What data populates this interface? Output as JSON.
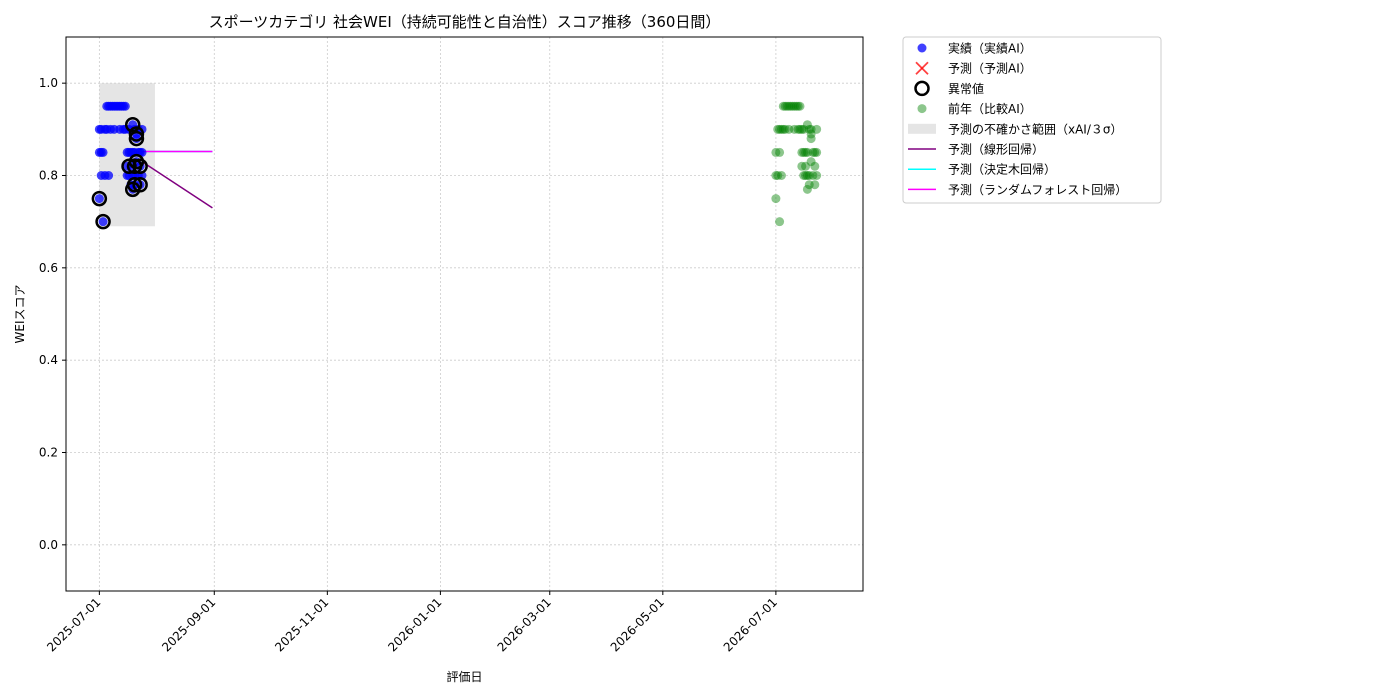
{
  "chart_data": {
    "type": "scatter",
    "title": "スポーツカテゴリ 社会WEI（持続可能性と自治性）スコア推移（360日間）",
    "xlabel": "評価日",
    "ylabel": "WEIスコア",
    "xlim": [
      "2025-06-13",
      "2026-08-17"
    ],
    "ylim": [
      -0.1,
      1.1
    ],
    "x_ticks": [
      "2025-07-01",
      "2025-09-01",
      "2025-11-01",
      "2026-01-01",
      "2026-03-01",
      "2026-05-01",
      "2026-07-01"
    ],
    "y_ticks": [
      0.0,
      0.2,
      0.4,
      0.6,
      0.8,
      1.0
    ],
    "y_tick_labels": [
      "0.0",
      "0.2",
      "0.4",
      "0.6",
      "0.8",
      "1.0"
    ],
    "grid": true,
    "legend_position": "outside-top-right",
    "colors": {
      "actual": "#0000ff",
      "forecast": "#ff0000",
      "anomaly": "#000000",
      "previous_year": "#008000",
      "band": "#d3d3d3",
      "linear": "#800080",
      "tree": "#00ffff",
      "forest": "#ff00ff"
    },
    "series": [
      {
        "name": "実績（実績AI）",
        "kind": "scatter",
        "color": "#0000ff",
        "points": [
          [
            "2025-07-01",
            0.75
          ],
          [
            "2025-07-01",
            0.85
          ],
          [
            "2025-07-01",
            0.9
          ],
          [
            "2025-07-02",
            0.8
          ],
          [
            "2025-07-02",
            0.85
          ],
          [
            "2025-07-02",
            0.9
          ],
          [
            "2025-07-03",
            0.7
          ],
          [
            "2025-07-03",
            0.85
          ],
          [
            "2025-07-04",
            0.9
          ],
          [
            "2025-07-04",
            0.8
          ],
          [
            "2025-07-05",
            0.95
          ],
          [
            "2025-07-05",
            0.9
          ],
          [
            "2025-07-06",
            0.8
          ],
          [
            "2025-07-06",
            0.95
          ],
          [
            "2025-07-07",
            0.95
          ],
          [
            "2025-07-07",
            0.9
          ],
          [
            "2025-07-08",
            0.95
          ],
          [
            "2025-07-09",
            0.95
          ],
          [
            "2025-07-09",
            0.9
          ],
          [
            "2025-07-10",
            0.95
          ],
          [
            "2025-07-11",
            0.95
          ],
          [
            "2025-07-12",
            0.95
          ],
          [
            "2025-07-12",
            0.9
          ],
          [
            "2025-07-13",
            0.95
          ],
          [
            "2025-07-14",
            0.95
          ],
          [
            "2025-07-14",
            0.9
          ],
          [
            "2025-07-15",
            0.95
          ],
          [
            "2025-07-15",
            0.9
          ],
          [
            "2025-07-16",
            0.85
          ],
          [
            "2025-07-16",
            0.8
          ],
          [
            "2025-07-16",
            0.82
          ],
          [
            "2025-07-17",
            0.85
          ],
          [
            "2025-07-17",
            0.8
          ],
          [
            "2025-07-17",
            0.9
          ],
          [
            "2025-07-18",
            0.85
          ],
          [
            "2025-07-18",
            0.78
          ],
          [
            "2025-07-18",
            0.82
          ],
          [
            "2025-07-19",
            0.91
          ],
          [
            "2025-07-19",
            0.85
          ],
          [
            "2025-07-19",
            0.8
          ],
          [
            "2025-07-19",
            0.77
          ],
          [
            "2025-07-20",
            0.9
          ],
          [
            "2025-07-20",
            0.85
          ],
          [
            "2025-07-20",
            0.8
          ],
          [
            "2025-07-20",
            0.78
          ],
          [
            "2025-07-21",
            0.89
          ],
          [
            "2025-07-21",
            0.83
          ],
          [
            "2025-07-21",
            0.88
          ],
          [
            "2025-07-22",
            0.9
          ],
          [
            "2025-07-22",
            0.85
          ],
          [
            "2025-07-22",
            0.8
          ],
          [
            "2025-07-23",
            0.85
          ],
          [
            "2025-07-23",
            0.82
          ],
          [
            "2025-07-23",
            0.78
          ],
          [
            "2025-07-24",
            0.9
          ],
          [
            "2025-07-24",
            0.85
          ],
          [
            "2025-07-24",
            0.8
          ]
        ]
      },
      {
        "name": "予測（予測AI）",
        "kind": "scatter",
        "color": "#ff0000",
        "points": []
      },
      {
        "name": "異常値",
        "kind": "scatter",
        "color": "#000000",
        "points": [
          [
            "2025-07-01",
            0.75
          ],
          [
            "2025-07-03",
            0.7
          ],
          [
            "2025-07-17",
            0.82
          ],
          [
            "2025-07-19",
            0.91
          ],
          [
            "2025-07-19",
            0.77
          ],
          [
            "2025-07-20",
            0.78
          ],
          [
            "2025-07-20",
            0.82
          ],
          [
            "2025-07-21",
            0.83
          ],
          [
            "2025-07-21",
            0.89
          ],
          [
            "2025-07-21",
            0.88
          ],
          [
            "2025-07-23",
            0.82
          ],
          [
            "2025-07-23",
            0.78
          ]
        ]
      },
      {
        "name": "前年（比較AI）",
        "kind": "scatter",
        "color": "#008000",
        "points": [
          [
            "2026-07-01",
            0.75
          ],
          [
            "2026-07-01",
            0.85
          ],
          [
            "2026-07-01",
            0.8
          ],
          [
            "2026-07-02",
            0.9
          ],
          [
            "2026-07-02",
            0.8
          ],
          [
            "2026-07-03",
            0.7
          ],
          [
            "2026-07-03",
            0.85
          ],
          [
            "2026-07-03",
            0.9
          ],
          [
            "2026-07-04",
            0.9
          ],
          [
            "2026-07-04",
            0.8
          ],
          [
            "2026-07-05",
            0.95
          ],
          [
            "2026-07-05",
            0.9
          ],
          [
            "2026-07-06",
            0.95
          ],
          [
            "2026-07-06",
            0.9
          ],
          [
            "2026-07-07",
            0.95
          ],
          [
            "2026-07-08",
            0.95
          ],
          [
            "2026-07-08",
            0.9
          ],
          [
            "2026-07-09",
            0.95
          ],
          [
            "2026-07-10",
            0.95
          ],
          [
            "2026-07-11",
            0.95
          ],
          [
            "2026-07-11",
            0.9
          ],
          [
            "2026-07-12",
            0.95
          ],
          [
            "2026-07-13",
            0.95
          ],
          [
            "2026-07-13",
            0.9
          ],
          [
            "2026-07-14",
            0.95
          ],
          [
            "2026-07-14",
            0.9
          ],
          [
            "2026-07-15",
            0.9
          ],
          [
            "2026-07-15",
            0.85
          ],
          [
            "2026-07-15",
            0.82
          ],
          [
            "2026-07-16",
            0.85
          ],
          [
            "2026-07-16",
            0.8
          ],
          [
            "2026-07-16",
            0.9
          ],
          [
            "2026-07-17",
            0.85
          ],
          [
            "2026-07-17",
            0.8
          ],
          [
            "2026-07-17",
            0.82
          ],
          [
            "2026-07-18",
            0.91
          ],
          [
            "2026-07-18",
            0.85
          ],
          [
            "2026-07-18",
            0.8
          ],
          [
            "2026-07-18",
            0.77
          ],
          [
            "2026-07-19",
            0.9
          ],
          [
            "2026-07-19",
            0.8
          ],
          [
            "2026-07-19",
            0.78
          ],
          [
            "2026-07-20",
            0.89
          ],
          [
            "2026-07-20",
            0.83
          ],
          [
            "2026-07-20",
            0.88
          ],
          [
            "2026-07-20",
            0.9
          ],
          [
            "2026-07-21",
            0.85
          ],
          [
            "2026-07-21",
            0.8
          ],
          [
            "2026-07-22",
            0.85
          ],
          [
            "2026-07-22",
            0.82
          ],
          [
            "2026-07-22",
            0.78
          ],
          [
            "2026-07-23",
            0.9
          ],
          [
            "2026-07-23",
            0.85
          ],
          [
            "2026-07-23",
            0.8
          ]
        ]
      },
      {
        "name": "予測の不確かさ範囲（xAI/３σ）",
        "kind": "band",
        "color": "#d3d3d3",
        "x": [
          "2025-07-01",
          "2025-07-31"
        ],
        "lower": 0.69,
        "upper": 1.0
      },
      {
        "name": "予測（線形回帰）",
        "kind": "line",
        "color": "#800080",
        "points": [
          [
            "2025-07-24",
            0.83
          ],
          [
            "2025-08-31",
            0.73
          ]
        ]
      },
      {
        "name": "予測（決定木回帰）",
        "kind": "line",
        "color": "#00ffff",
        "points": [
          [
            "2025-07-24",
            0.852
          ],
          [
            "2025-08-31",
            0.852
          ]
        ]
      },
      {
        "name": "予測（ランダムフォレスト回帰）",
        "kind": "line",
        "color": "#ff00ff",
        "points": [
          [
            "2025-07-24",
            0.852
          ],
          [
            "2025-08-31",
            0.852
          ]
        ]
      }
    ]
  }
}
